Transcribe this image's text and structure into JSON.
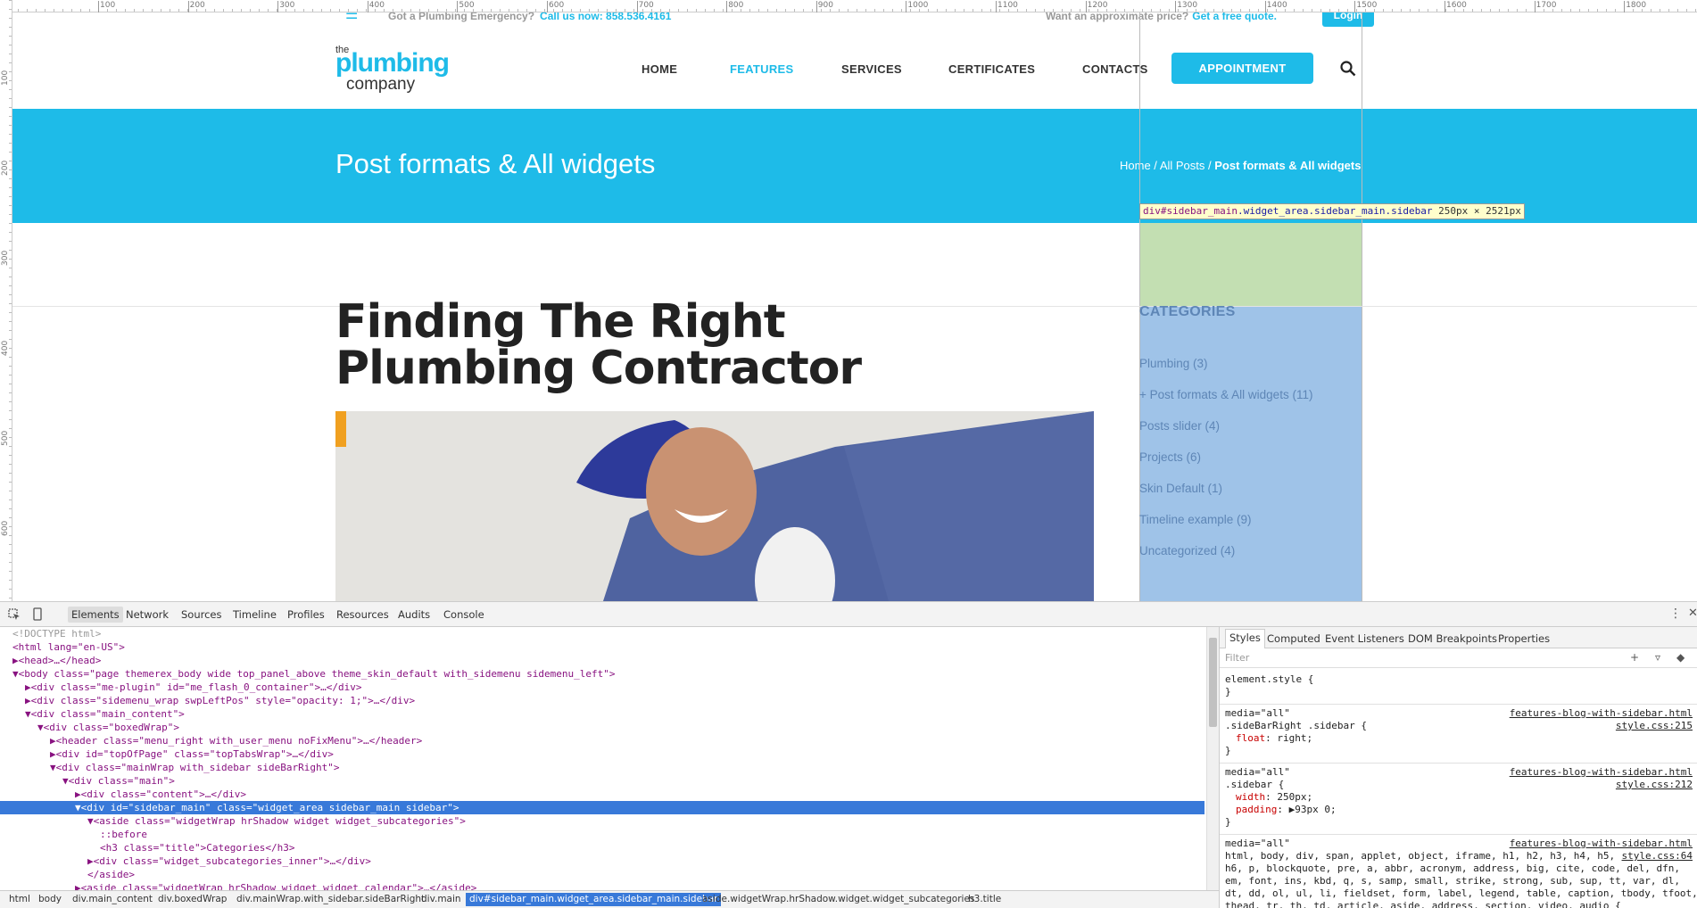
{
  "topbar": {
    "emergency": "Got a Plumbing Emergency?",
    "call": "Call us now: 858.536.4161",
    "quote_text": "Want an approximate price?",
    "quote_link": "Get a free quote.",
    "login": "Login"
  },
  "logo": {
    "the": "the",
    "plumbing": "plumbing",
    "company": "company"
  },
  "nav": {
    "home": "HOME",
    "features": "FEATURES",
    "services": "SERVICES",
    "certificates": "CERTIFICATES",
    "contacts": "CONTACTS",
    "appointment": "APPOINTMENT"
  },
  "banner": {
    "title": "Post formats & All widgets",
    "crumb_home": "Home",
    "crumb_sep1": " / ",
    "crumb_posts": "All Posts",
    "crumb_sep2": " / ",
    "crumb_current": "Post formats & All widgets"
  },
  "post": {
    "title": "Finding The Right Plumbing Contractor"
  },
  "sidebar": {
    "title": "CATEGORIES",
    "items": [
      "Plumbing (3)",
      "+ Post formats & All widgets (11)",
      "Posts slider (4)",
      "Projects (6)",
      "Skin Default (1)",
      "Timeline example (9)",
      "Uncategorized (4)"
    ]
  },
  "tooltip": {
    "tag": "div",
    "id": "#sidebar_main",
    "classes": ".widget_area.sidebar_main.sidebar",
    "size": "250px × 2521px"
  },
  "rulers": {
    "top": [
      "100",
      "200",
      "300",
      "400",
      "500",
      "600",
      "700",
      "800",
      "900",
      "1000",
      "1100",
      "1200",
      "1300",
      "1400",
      "1500",
      "1600",
      "1700",
      "1800"
    ],
    "left": [
      "100",
      "200",
      "300",
      "400",
      "500",
      "600"
    ]
  },
  "devtools": {
    "tabs": [
      "Elements",
      "Network",
      "Sources",
      "Timeline",
      "Profiles",
      "Resources",
      "Audits",
      "Console"
    ],
    "dom": [
      "<!DOCTYPE html>",
      "<html lang=\"en-US\">",
      "▶<head>…</head>",
      "▼<body class=\"page themerex_body wide top_panel_above theme_skin_default with_sidemenu sidemenu_left\">",
      "▶<div class=\"me-plugin\" id=\"me_flash_0_container\">…</div>",
      "▶<div class=\"sidemenu_wrap swpLeftPos\" style=\"opacity: 1;\">…</div>",
      "▼<div class=\"main_content\">",
      "▼<div class=\"boxedWrap\">",
      "▶<header class=\"menu_right with_user_menu noFixMenu\">…</header>",
      "▶<div id=\"topOfPage\" class=\"topTabsWrap\">…</div>",
      "▼<div class=\"mainWrap with_sidebar sideBarRight\">",
      "▼<div class=\"main\">",
      "▶<div class=\"content\">…</div>",
      "▼<div id=\"sidebar_main\" class=\"widget_area sidebar_main sidebar\">",
      "▼<aside class=\"widgetWrap hrShadow widget widget_subcategories\">",
      "::before",
      "<h3 class=\"title\">Categories</h3>",
      "▶<div class=\"widget_subcategories_inner\">…</div>",
      "</aside>",
      "▶<aside class=\"widgetWrap hrShadow widget widget_calendar\">…</aside>"
    ],
    "crumbs": [
      "html",
      "body",
      "div.main_content",
      "div.boxedWrap",
      "div.mainWrap.with_sidebar.sideBarRight",
      "div.main",
      "div#sidebar_main.widget_area.sidebar_main.sidebar",
      "aside.widgetWrap.hrShadow.widget.widget_subcategories",
      "h3.title"
    ],
    "styles_tabs": [
      "Styles",
      "Computed",
      "Event Listeners",
      "DOM Breakpoints",
      "Properties"
    ],
    "filter_placeholder": "Filter",
    "rules": [
      {
        "selector": "element.style {",
        "decls": [],
        "close": "}"
      },
      {
        "media": "media=\"all\"",
        "source": "features-blog-with-sidebar.html",
        "file": "style.css:215",
        "selector": ".sideBarRight .sidebar {",
        "decls": [
          [
            "float",
            "right;"
          ]
        ],
        "close": "}"
      },
      {
        "media": "media=\"all\"",
        "source": "features-blog-with-sidebar.html",
        "file": "style.css:212",
        "selector": ".sidebar {",
        "decls": [
          [
            "width",
            "250px;"
          ],
          [
            "padding",
            "▶93px 0;"
          ]
        ],
        "close": "}"
      },
      {
        "media": "media=\"all\"",
        "source": "features-blog-with-sidebar.html",
        "file": "style.css:64",
        "selector": "html, body, div, span, applet, object, iframe, h1, h2, h3, h4, h5,",
        "more": [
          "h6, p, blockquote, pre, a, abbr, acronym, address, big, cite, code, del, dfn,",
          "em, font, ins, kbd, q, s, samp, small, strike, strong, sub, sup, tt, var, dl,",
          "dt, dd, ol, ul, li, fieldset, form, label, legend, table, caption, tbody, tfoot,",
          "thead, tr, th, td, article, aside, address, section, video, audio {"
        ]
      }
    ]
  }
}
